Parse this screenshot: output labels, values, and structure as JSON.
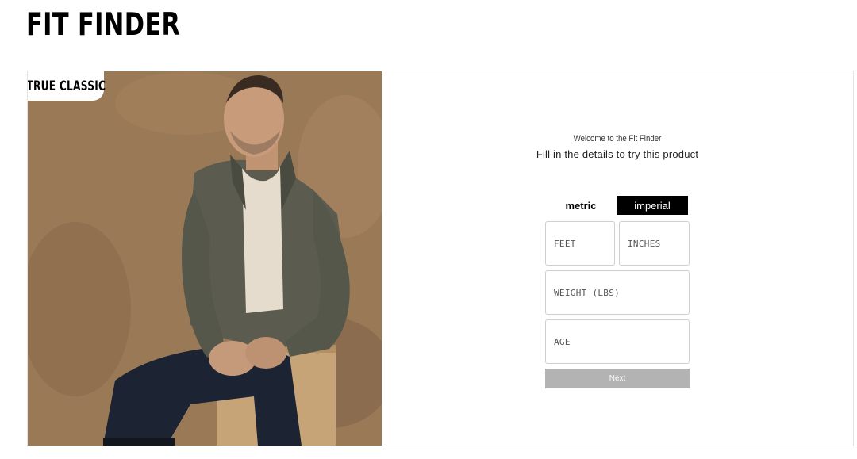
{
  "header": {
    "title": "FIT FINDER"
  },
  "brand": {
    "logo_text": "TRUE CLASSIC"
  },
  "form": {
    "welcome": "Welcome to the Fit Finder",
    "subtitle": "Fill in the details to try this product",
    "units": {
      "metric_label": "metric",
      "imperial_label": "imperial",
      "selected": "imperial"
    },
    "fields": {
      "feet_placeholder": "FEET",
      "inches_placeholder": "INCHES",
      "weight_placeholder": "WEIGHT (LBS)",
      "age_placeholder": "AGE"
    },
    "next_label": "Next"
  },
  "colors": {
    "toggle_active_bg": "#000000",
    "next_disabled_bg": "#b3b3b3",
    "field_border": "#cfcfcf"
  }
}
